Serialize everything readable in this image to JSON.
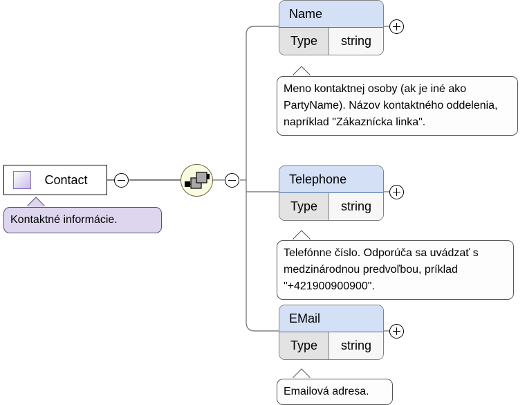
{
  "diagram": {
    "type": "xml-schema-element-diagram",
    "root": {
      "name": "Contact",
      "icon": "element-icon",
      "toggle": "collapse-minus",
      "annotation": "Kontaktné informácie."
    },
    "compositor": {
      "icon": "sequence-icon",
      "toggle": "collapse-minus"
    },
    "children": [
      {
        "name": "Name",
        "attr_key": "Type",
        "attr_value": "string",
        "toggle": "expand-plus",
        "annotation": "Meno kontaktnej osoby (ak je iné ako PartyName). Názov kontaktného oddelenia, napríklad \"Zákaznícka linka\"."
      },
      {
        "name": "Telephone",
        "attr_key": "Type",
        "attr_value": "string",
        "toggle": "expand-plus",
        "annotation": "Telefónne číslo. Odporúča sa uvádzať s medzinárodnou predvoľbou, príklad \"+421900900900\"."
      },
      {
        "name": "EMail",
        "attr_key": "Type",
        "attr_value": "string",
        "toggle": "expand-plus",
        "annotation": "Emailová adresa."
      }
    ],
    "colors": {
      "element_header": "#d3e0f5",
      "attr_key_bg": "#e3e3e3",
      "attr_value_bg": "#f7f7f7",
      "compositor_bg": "#fbfbe0",
      "root_annotation_bg": "#ddd6ee",
      "connector": "#808080"
    }
  }
}
